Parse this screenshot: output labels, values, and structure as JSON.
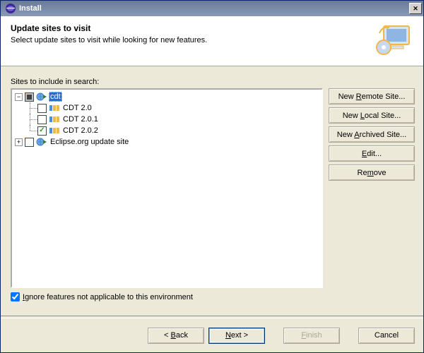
{
  "window": {
    "title": "Install"
  },
  "header": {
    "title": "Update sites to visit",
    "subtitle": "Select update sites to visit while looking for new features."
  },
  "body": {
    "sites_label": "Sites to include in search:",
    "tree": {
      "cdt": {
        "label": "cdt",
        "selected": true,
        "state": "partial",
        "expanded": true,
        "children": [
          {
            "label": "CDT 2.0",
            "checked": false
          },
          {
            "label": "CDT 2.0.1",
            "checked": false
          },
          {
            "label": "CDT 2.0.2",
            "checked": true
          }
        ]
      },
      "eclipse": {
        "label": "Eclipse.org update site",
        "checked": false,
        "expanded": false
      }
    },
    "side_buttons": {
      "remote": "New Remote Site...",
      "local": "New Local Site...",
      "archived": "New Archived Site...",
      "edit": "Edit...",
      "remove": "Remove"
    },
    "ignore_label_pre": "I",
    "ignore_label_rest": "gnore features not applicable to this environment",
    "ignore_checked": true
  },
  "footer": {
    "back": "< Back",
    "next": "Next >",
    "finish": "Finish",
    "cancel": "Cancel"
  },
  "mnemonics": {
    "back": "B",
    "next": "N",
    "finish": "F",
    "remote": "R",
    "local": "L",
    "archived": "A",
    "edit": "E",
    "remove": "m"
  }
}
